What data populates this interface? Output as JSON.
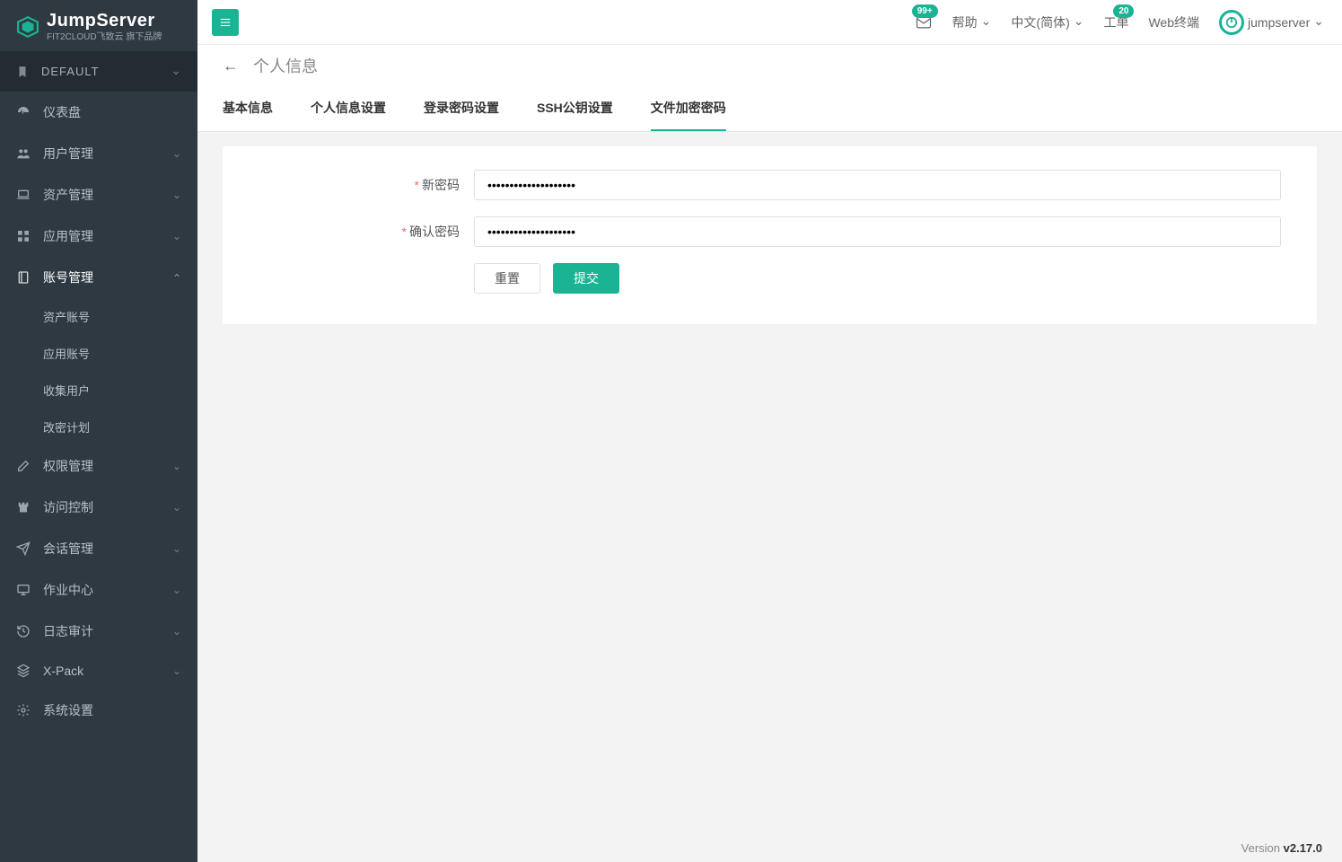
{
  "brand": {
    "title": "JumpServer",
    "subtitle": "FIT2CLOUD飞致云 旗下品牌"
  },
  "org": {
    "label": "DEFAULT"
  },
  "sidebar": {
    "items": [
      {
        "label": "仪表盘",
        "icon": "dashboard-icon",
        "expandable": false
      },
      {
        "label": "用户管理",
        "icon": "users-icon",
        "expandable": true
      },
      {
        "label": "资产管理",
        "icon": "laptop-icon",
        "expandable": true
      },
      {
        "label": "应用管理",
        "icon": "grid-icon",
        "expandable": true
      },
      {
        "label": "账号管理",
        "icon": "notebook-icon",
        "expandable": true,
        "expanded": true,
        "sub": [
          {
            "label": "资产账号"
          },
          {
            "label": "应用账号"
          },
          {
            "label": "收集用户"
          },
          {
            "label": "改密计划"
          }
        ]
      },
      {
        "label": "权限管理",
        "icon": "edit-icon",
        "expandable": true
      },
      {
        "label": "访问控制",
        "icon": "fort-icon",
        "expandable": true
      },
      {
        "label": "会话管理",
        "icon": "paperplane-icon",
        "expandable": true
      },
      {
        "label": "作业中心",
        "icon": "desktop-icon",
        "expandable": true
      },
      {
        "label": "日志审计",
        "icon": "history-icon",
        "expandable": true
      },
      {
        "label": "X-Pack",
        "icon": "stack-icon",
        "expandable": true
      },
      {
        "label": "系统设置",
        "icon": "cogs-icon",
        "expandable": false
      }
    ]
  },
  "topbar": {
    "mail_badge": "99+",
    "help": "帮助",
    "lang": "中文(简体)",
    "ticket": "工单",
    "ticket_badge": "20",
    "webterm": "Web终端",
    "user": "jumpserver"
  },
  "page": {
    "title": "个人信息"
  },
  "tabs": [
    {
      "label": "基本信息"
    },
    {
      "label": "个人信息设置"
    },
    {
      "label": "登录密码设置"
    },
    {
      "label": "SSH公钥设置"
    },
    {
      "label": "文件加密密码",
      "active": true
    }
  ],
  "form": {
    "new_password_label": "新密码",
    "confirm_password_label": "确认密码",
    "new_password_value": "••••••••••••••••••••",
    "confirm_password_value": "••••••••••••••••••••",
    "reset": "重置",
    "submit": "提交"
  },
  "footer": {
    "prefix": "Version ",
    "version": "v2.17.0"
  }
}
